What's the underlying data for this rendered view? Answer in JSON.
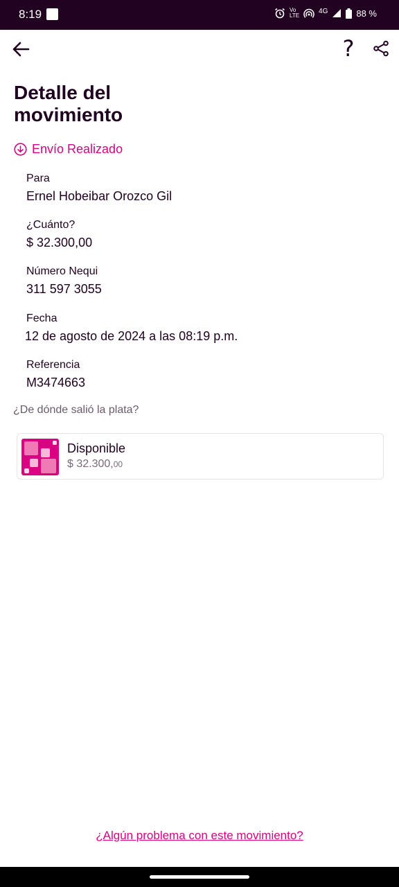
{
  "status_bar": {
    "time": "8:19",
    "battery": "88 %",
    "network": "4G",
    "volte": "Vo LTE"
  },
  "app_bar": {
    "help": "?"
  },
  "page": {
    "title": "Detalle del movimiento",
    "status": "Envío Realizado"
  },
  "details": [
    {
      "label": "Para",
      "value": "Ernel Hobeibar Orozco Gil"
    },
    {
      "label": "¿Cuánto?",
      "value": "$ 32.300,00"
    },
    {
      "label": "Número Nequi",
      "value": "311 597 3055"
    },
    {
      "label": "Fecha",
      "value": "12 de agosto de 2024 a las 08:19 p.m."
    },
    {
      "label": "Referencia",
      "value": "M3474663"
    }
  ],
  "source": {
    "question": "¿De dónde salió la plata?",
    "account_name": "Disponible",
    "balance_main": "$ 32.300,",
    "balance_cents": "00"
  },
  "footer": {
    "problem_link": "¿Algún problema con este movimiento?"
  },
  "colors": {
    "brand": "#da0081",
    "status_bar_bg": "#210321",
    "text": "#200020"
  }
}
